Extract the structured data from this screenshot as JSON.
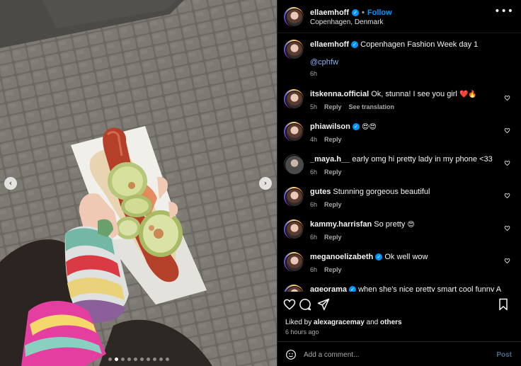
{
  "post": {
    "username": "ellaemhoff",
    "follow_label": "Follow",
    "separator": "•",
    "location": "Copenhagen, Denmark",
    "more_label": "•••"
  },
  "caption": {
    "username": "ellaemhoff",
    "text": "Copenhagen Fashion Week day 1",
    "mention": "@cphfw",
    "time": "6h"
  },
  "comments": [
    {
      "username": "itskenna.official",
      "text": "Ok, stunna! I see you girl",
      "emoji": "❤️🔥",
      "time": "5h",
      "reply": "Reply",
      "translate": "See translation",
      "verified": false
    },
    {
      "username": "phiawilson",
      "text": "",
      "emoji": "😍😍",
      "time": "4h",
      "reply": "Reply",
      "verified": true
    },
    {
      "username": "_maya.h__",
      "text": "early omg hi pretty lady in my phone <33",
      "emoji": "",
      "time": "6h",
      "reply": "Reply",
      "verified": false
    },
    {
      "username": "gutes",
      "text": "Stunning gorgeous beautiful",
      "emoji": "",
      "time": "6h",
      "reply": "Reply",
      "verified": false
    },
    {
      "username": "kammy.harrisfan",
      "text": "So pretty",
      "emoji": "😍",
      "time": "6h",
      "reply": "Reply",
      "verified": false
    },
    {
      "username": "meganoelizabeth",
      "text": "Ok well wow",
      "emoji": "",
      "time": "6h",
      "reply": "Reply",
      "verified": true
    },
    {
      "username": "ageorama",
      "text": "when she's nice pretty smart cool funny AND",
      "emoji": "",
      "time": "",
      "reply": "",
      "verified": true
    }
  ],
  "engagement": {
    "liked_prefix": "Liked by",
    "liked_user": "alexagracemay",
    "liked_and": "and",
    "liked_others": "others",
    "time_ago": "6 hours ago"
  },
  "comment_box": {
    "placeholder": "Add a comment...",
    "post_label": "Post"
  },
  "carousel": {
    "prev_label": "‹",
    "next_label": "›",
    "slide_count": 10,
    "active_index": 1
  },
  "colors": {
    "link_blue": "#0095f6",
    "like_red": "#ff3040",
    "background": "#000000"
  }
}
